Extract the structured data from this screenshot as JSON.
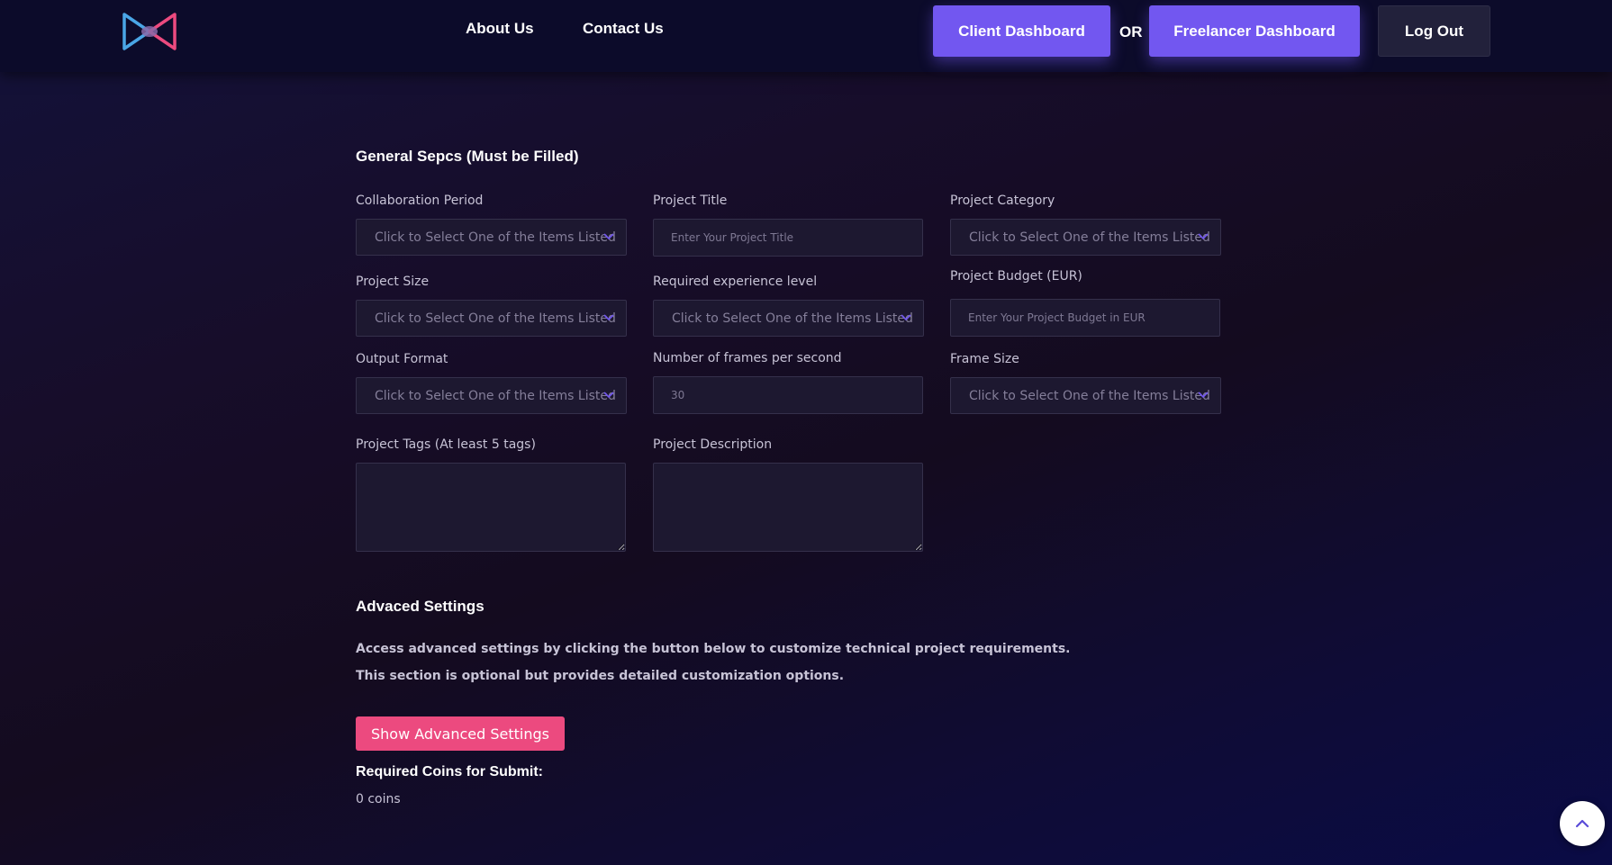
{
  "header": {
    "nav": {
      "about": "About Us",
      "contact": "Contact Us"
    },
    "client_dashboard": "Client Dashboard",
    "or_text": "OR",
    "freelancer_dashboard": "Freelancer Dashboard",
    "logout": "Log Out"
  },
  "general": {
    "title": "General Sepcs (Must be Filled)",
    "select_placeholder": "Click to Select One of the Items Listed",
    "collaboration_period": {
      "label": "Collaboration Period"
    },
    "project_title": {
      "label": "Project Title",
      "placeholder": "Enter Your Project Title"
    },
    "project_category": {
      "label": "Project Category"
    },
    "project_size": {
      "label": "Project Size"
    },
    "experience_level": {
      "label": "Required experience level"
    },
    "project_budget": {
      "label": "Project Budget (EUR)",
      "placeholder": "Enter Your Project Budget in EUR"
    },
    "output_format": {
      "label": "Output Format"
    },
    "fps": {
      "label": "Number of frames per second",
      "placeholder": "30"
    },
    "frame_size": {
      "label": "Frame Size"
    },
    "project_tags": {
      "label": "Project Tags (At least 5 tags)"
    },
    "project_description": {
      "label": "Project Description"
    }
  },
  "advanced": {
    "title": "Advaced Settings",
    "line1": "Access advanced settings by clicking the button below to customize technical project requirements.",
    "line2": "This section is optional but provides detailed customization options.",
    "button": "Show Advanced Settings"
  },
  "coins": {
    "label": "Required Coins for Submit:",
    "value": "0 coins"
  },
  "colors": {
    "accent_purple": "#7257f0",
    "accent_pink": "#ec4a7f",
    "header_bg": "#0c0b2a"
  },
  "icons": [
    "logo-bowtie-icon",
    "chevron-down-icon",
    "chevron-up-icon"
  ]
}
